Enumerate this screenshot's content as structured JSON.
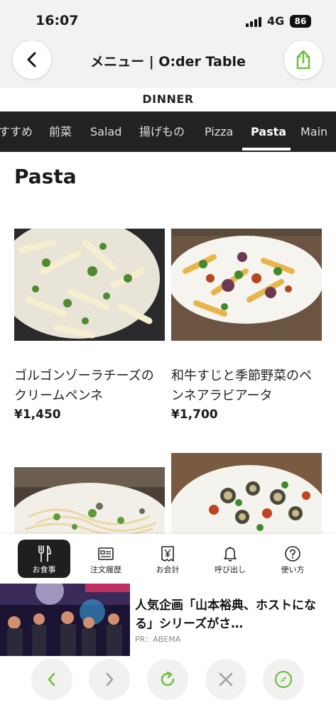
{
  "status": {
    "time": "16:07",
    "network": "4G",
    "battery": "86"
  },
  "header": {
    "title": "メニュー | O:der Table"
  },
  "meal_period": "DINNER",
  "tabs": [
    {
      "label": "すすめ"
    },
    {
      "label": "前菜"
    },
    {
      "label": "Salad"
    },
    {
      "label": "揚げもの"
    },
    {
      "label": "Pizza"
    },
    {
      "label": "Pasta",
      "active": true
    },
    {
      "label": "Main"
    }
  ],
  "section_title": "Pasta",
  "items": [
    {
      "name": "ゴルゴンゾーラチーズのクリームペンネ",
      "price": "¥1,450"
    },
    {
      "name": "和牛すじと季節野菜のペンネアラビアータ",
      "price": "¥1,700"
    },
    {
      "name": "",
      "price": ""
    },
    {
      "name": "",
      "price": ""
    }
  ],
  "bottom_nav": [
    {
      "label": "お食事",
      "icon": "fork-knife-icon",
      "active": true
    },
    {
      "label": "注文履歴",
      "icon": "history-icon"
    },
    {
      "label": "お会計",
      "icon": "receipt-yen-icon"
    },
    {
      "label": "呼び出し",
      "icon": "bell-icon"
    },
    {
      "label": "使い方",
      "icon": "help-icon"
    }
  ],
  "ad": {
    "title": "人気企画「山本裕典、ホストになる」シリーズがさ…",
    "source": "PR：ABEMA"
  },
  "colors": {
    "accent_green": "#6cbf3c",
    "tab_bar": "#222222",
    "header_bg": "#f2f2f2"
  }
}
